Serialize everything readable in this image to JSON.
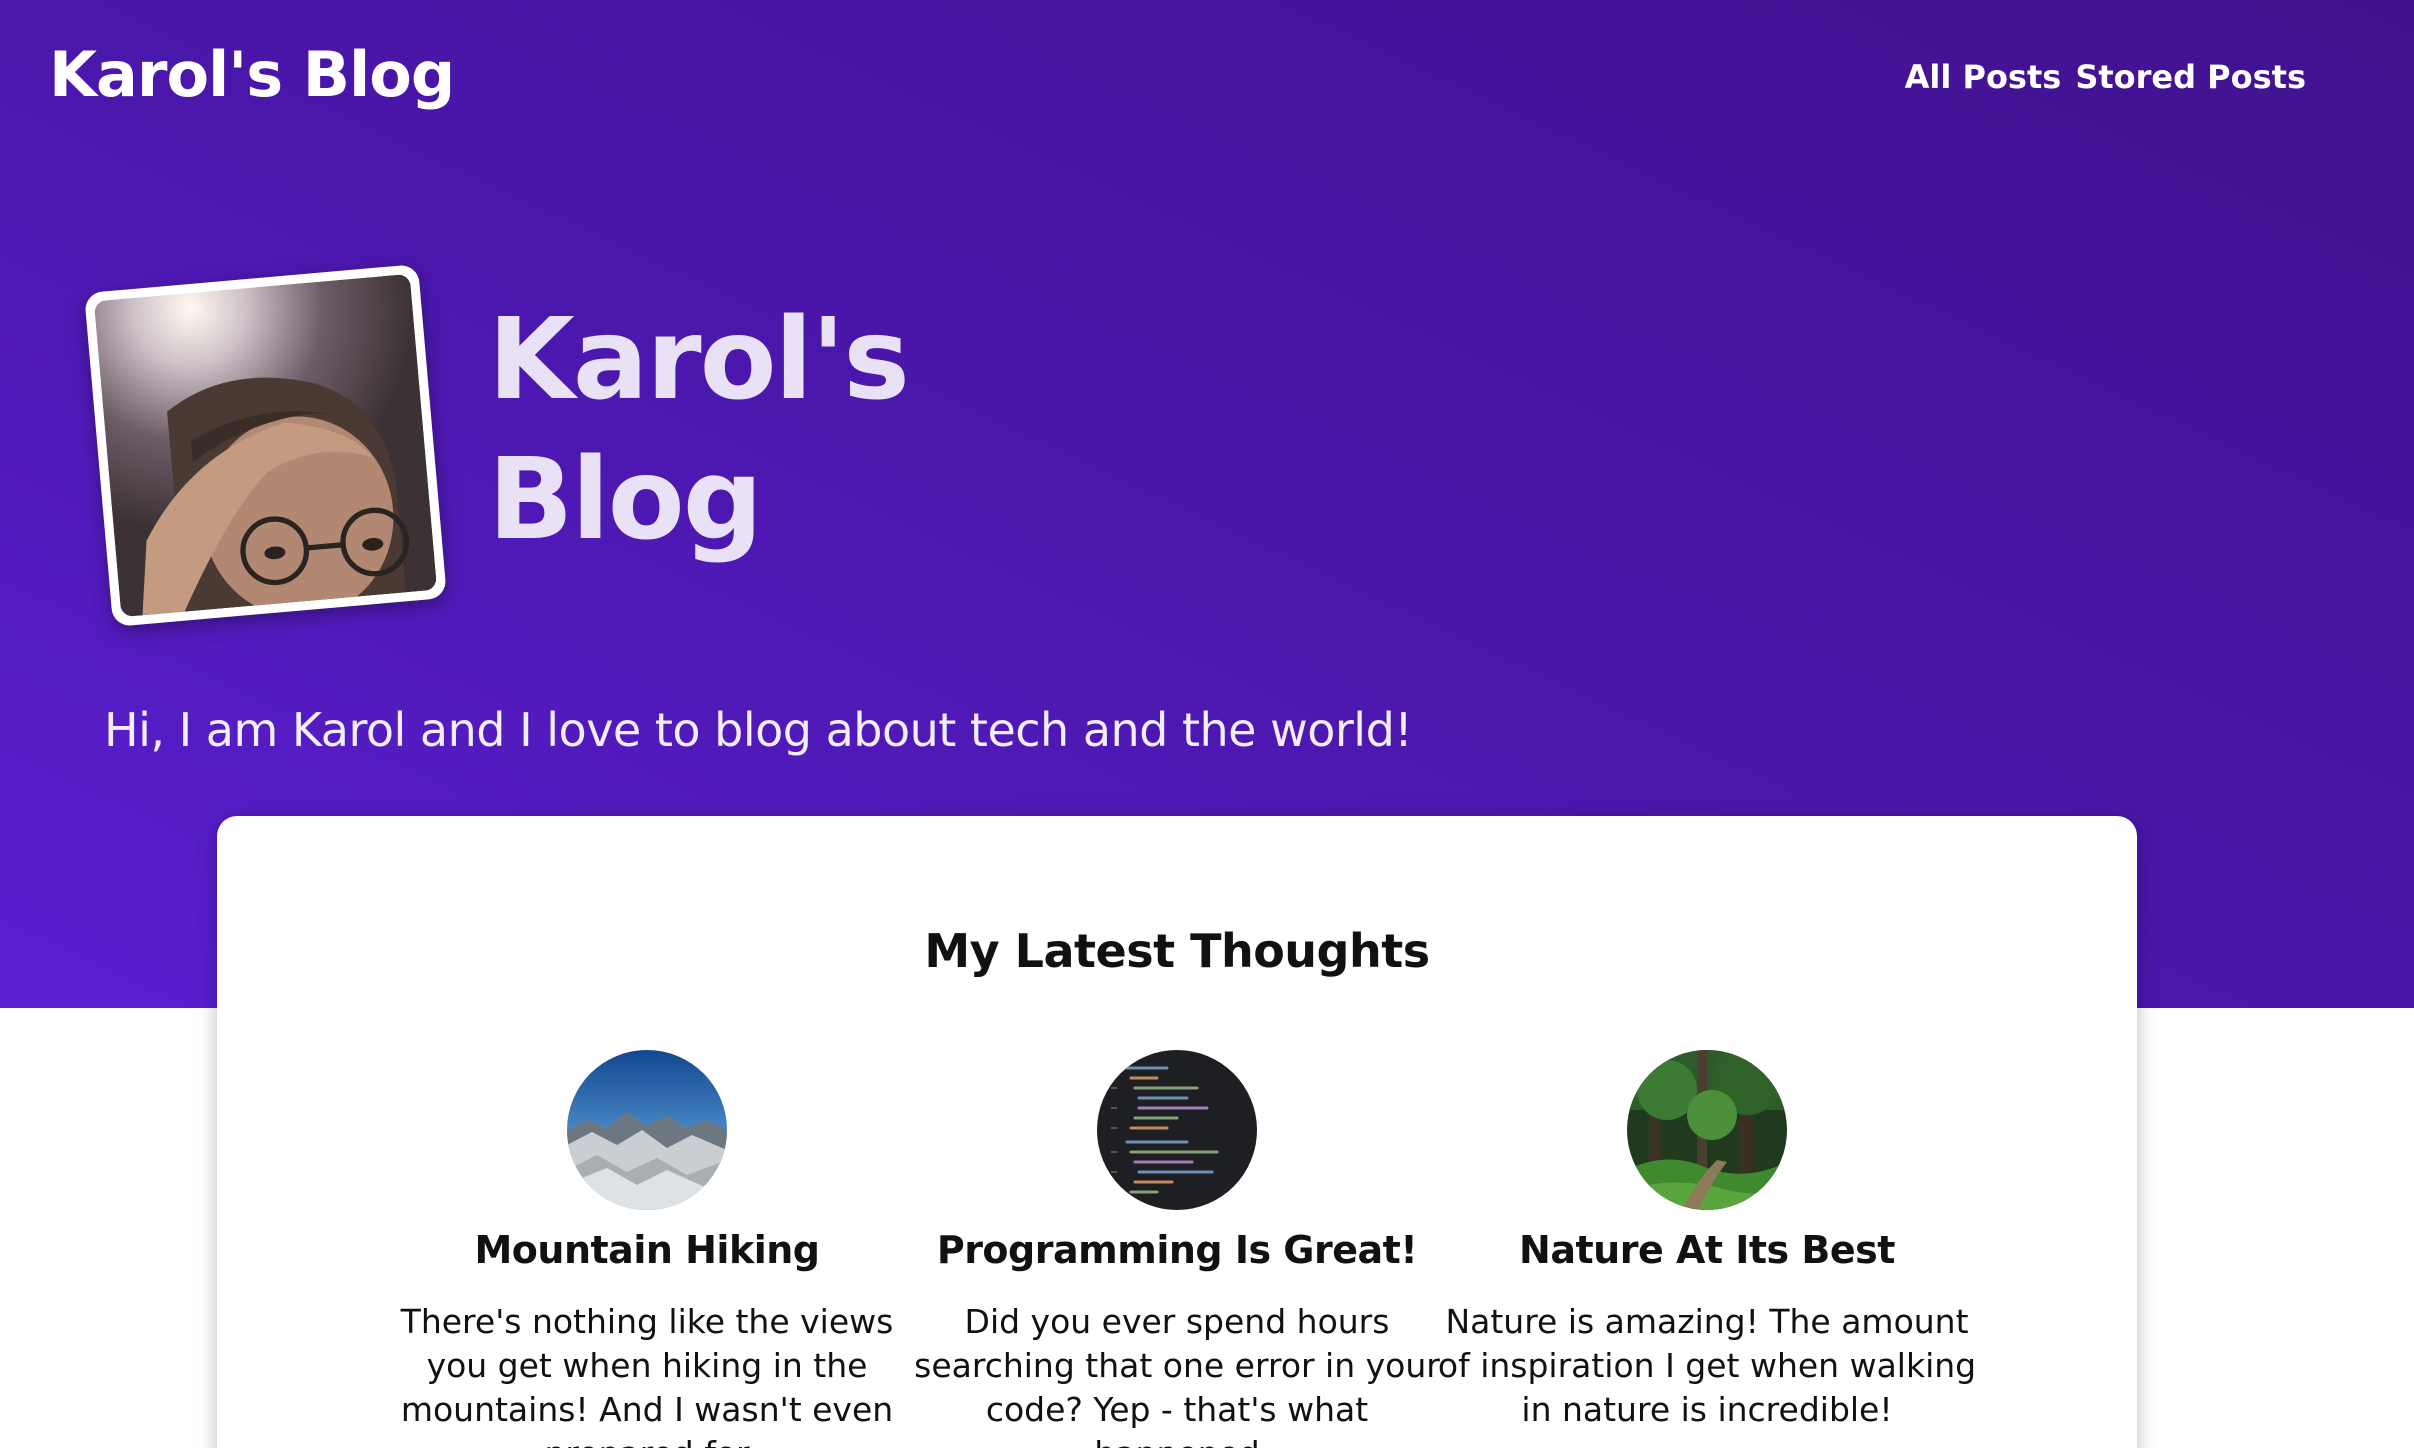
{
  "header": {
    "logo": "Karol's Blog",
    "nav": [
      {
        "label": "All Posts"
      },
      {
        "label": "Stored Posts"
      }
    ]
  },
  "hero": {
    "title_line1": "Karol's",
    "title_line2": "Blog",
    "tagline": "Hi, I am Karol and I love to blog about tech and the world!"
  },
  "latest": {
    "heading": "My Latest Thoughts",
    "posts": [
      {
        "title": "Mountain Hiking",
        "excerpt": "There's nothing like the views you get when hiking in the mountains! And I wasn't even prepared for",
        "image": "mountains"
      },
      {
        "title": "Programming Is Great!",
        "excerpt": "Did you ever spend hours searching that one error in your code? Yep - that's what happened",
        "image": "code"
      },
      {
        "title": "Nature At Its Best",
        "excerpt": "Nature is amazing! The amount of inspiration I get when walking in nature is incredible!",
        "image": "forest"
      }
    ]
  },
  "colors": {
    "hero_purple": "#4b17ad",
    "hero_purple_light": "#5a1fd1",
    "card_bg": "#ffffff"
  }
}
